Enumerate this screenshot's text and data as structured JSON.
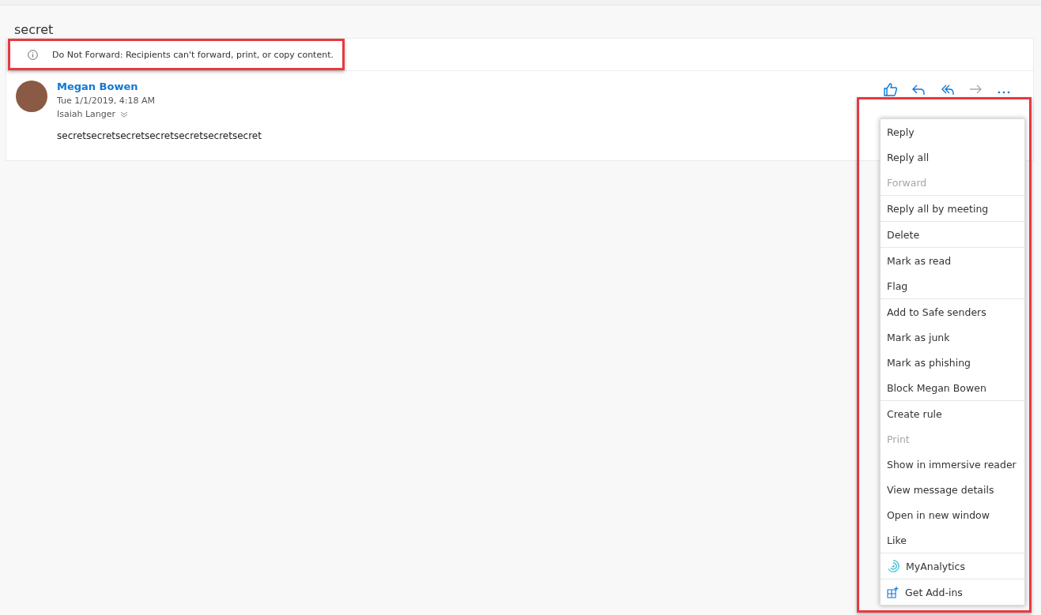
{
  "subject": "secret",
  "notice": {
    "text": "Do Not Forward: Recipients can't forward, print, or copy content.",
    "highlighted": true
  },
  "message": {
    "sender": "Megan Bowen",
    "date": "Tue 1/1/2019, 4:18 AM",
    "recipient": "Isaiah Langer",
    "body": "secretsecretsecretsecretsecretsecretsecret"
  },
  "actions": [
    {
      "kind": "like",
      "disabled": false
    },
    {
      "kind": "reply",
      "disabled": false
    },
    {
      "kind": "reply_all",
      "disabled": false
    },
    {
      "kind": "forward",
      "disabled": true
    },
    {
      "kind": "more",
      "disabled": false
    }
  ],
  "menu": {
    "highlighted": true,
    "groups": [
      [
        {
          "label": "Reply",
          "disabled": false
        },
        {
          "label": "Reply all",
          "disabled": false
        },
        {
          "label": "Forward",
          "disabled": true
        }
      ],
      [
        {
          "label": "Reply all by meeting",
          "disabled": false
        }
      ],
      [
        {
          "label": "Delete",
          "disabled": false
        }
      ],
      [
        {
          "label": "Mark as read",
          "disabled": false
        },
        {
          "label": "Flag",
          "disabled": false
        }
      ],
      [
        {
          "label": "Add to Safe senders",
          "disabled": false
        },
        {
          "label": "Mark as junk",
          "disabled": false
        },
        {
          "label": "Mark as phishing",
          "disabled": false
        },
        {
          "label": "Block Megan Bowen",
          "disabled": false
        }
      ],
      [
        {
          "label": "Create rule",
          "disabled": false
        },
        {
          "label": "Print",
          "disabled": true
        },
        {
          "label": "Show in immersive reader",
          "disabled": false
        },
        {
          "label": "View message details",
          "disabled": false
        },
        {
          "label": "Open in new window",
          "disabled": false
        },
        {
          "label": "Like",
          "disabled": false
        }
      ],
      [
        {
          "label": "MyAnalytics",
          "disabled": false,
          "kind": "analytics"
        }
      ],
      [
        {
          "label": "Get Add-ins",
          "disabled": false,
          "kind": "addins"
        }
      ]
    ]
  }
}
